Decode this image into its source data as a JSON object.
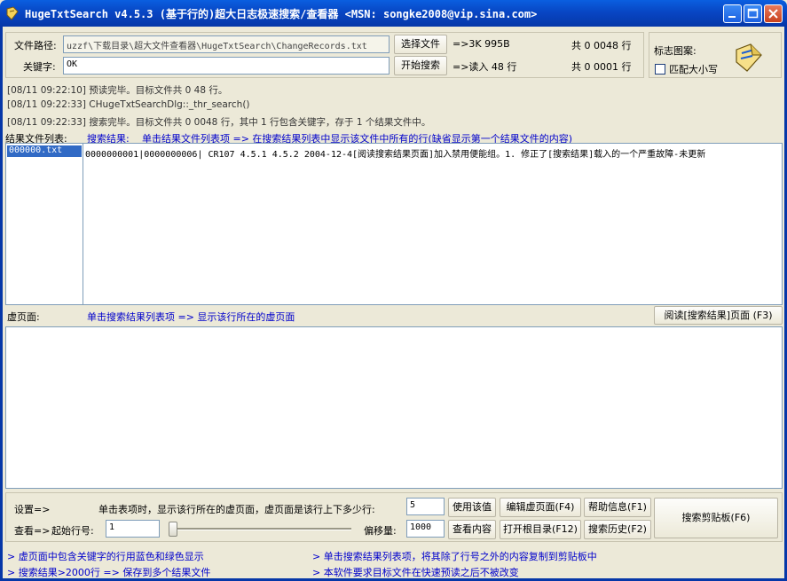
{
  "window": {
    "title": "HugeTxtSearch v4.5.3 (基于行的)超大日志极速搜索/查看器 <MSN: songke2008@vip.sina.com>"
  },
  "top": {
    "path_label": "文件路径:",
    "path_value": "uzzf\\下载目录\\超大文件查看器\\HugeTxtSearch\\ChangeRecords.txt",
    "choose_file_label": "选择文件",
    "size_info": "=>3K 995B",
    "total_lines_1": "共 0 0048 行",
    "keyword_label": "关键字:",
    "keyword_value": "OK",
    "start_search_label": "开始搜索",
    "read_info": "=>读入 48 行",
    "total_lines_2": "共 0 0001 行",
    "logo_label": "标志图案:",
    "match_case_label": "匹配大小写"
  },
  "log": [
    "[08/11 09:22:10] 预读完毕。目标文件共 0 48 行。",
    "[08/11 09:22:33] CHugeTxtSearchDlg::_thr_search()",
    "[08/11 09:22:33] 搜索完毕。目标文件共 0 0048 行，其中 1 行包含关键字，存于 1 个结果文件中。"
  ],
  "results": {
    "files_label": "结果文件列表:",
    "search_result_label": "搜索结果:",
    "search_hint": "单击结果文件列表项 => 在搜索结果列表中显示该文件中所有的行(缺省显示第一个结果文件的内容)",
    "files": [
      "000000.txt"
    ],
    "rows": [
      "0000000001|0000000006| CR107  4.5.1  4.5.2  2004-12-4[阅读搜索结果页面]加入禁用便能组。1. 修正了[搜索结果]载入的一个严重故障-未更新"
    ]
  },
  "virtual": {
    "label": "虚页面:",
    "hint": "单击搜索结果列表项 => 显示该行所在的虚页面",
    "read_page_button": "阅读[搜索结果]页面 (F3)"
  },
  "bottom": {
    "settings_label": "设置=>",
    "settings_hint": "单击表项时，显示该行所在的虚页面，虚页面是该行上下多少行:",
    "lines_value": "5",
    "use_value_button": "使用该值",
    "edit_page_button": "编辑虚页面(F4)",
    "help_button": "帮助信息(F1)",
    "clipboard_button": "搜索剪贴板(F6)",
    "view_label": "查看=>",
    "start_line_label": "起始行号:",
    "start_line_value": "1",
    "offset_label": "偏移量:",
    "offset_value": "1000",
    "view_content_button": "查看内容",
    "open_root_button": "打开根目录(F12)",
    "history_button": "搜索历史(F2)"
  },
  "tips": [
    "> 虚页面中包含关键字的行用蓝色和绿色显示",
    "> 单击搜索结果列表项，将其除了行号之外的内容复制到剪贴板中",
    "> 搜索结果>2000行 => 保存到多个结果文件",
    "> 本软件要求目标文件在快速预读之后不被改变"
  ],
  "colors": {
    "title_bar": "#0846c4",
    "selection": "#316ac5",
    "link_blue": "#0000cc"
  }
}
